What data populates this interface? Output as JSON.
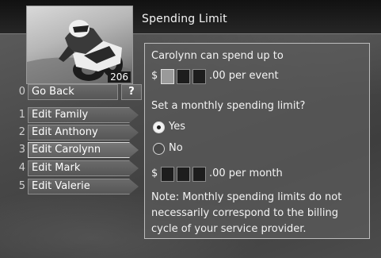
{
  "header": {
    "title": "Spending Limit"
  },
  "thumbnail": {
    "channel": "206"
  },
  "menu": {
    "go_back": {
      "number": "0",
      "label": "Go Back"
    },
    "help_label": "?",
    "items": [
      {
        "number": "1",
        "label": "Edit Family"
      },
      {
        "number": "2",
        "label": "Edit Anthony"
      },
      {
        "number": "3",
        "label": "Edit Carolynn"
      },
      {
        "number": "4",
        "label": "Edit Mark"
      },
      {
        "number": "5",
        "label": "Edit Valerie"
      }
    ]
  },
  "panel": {
    "per_event_label": "Carolynn can spend up to",
    "currency": "$",
    "per_event_suffix": ".00 per event",
    "monthly_question": "Set a monthly spending limit?",
    "option_yes": "Yes",
    "option_no": "No",
    "selected_option": "Yes",
    "per_month_suffix": ".00 per month",
    "note": "Note: Monthly spending limits do not necessarily correspond to the billing cycle of your service provider."
  }
}
